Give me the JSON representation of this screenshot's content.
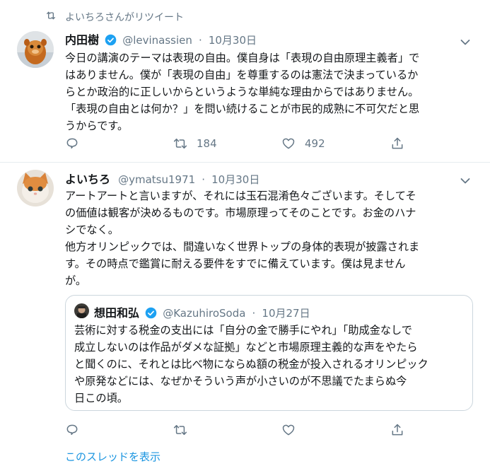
{
  "retweet_header": {
    "text": "よいちろさんがリツイート",
    "icon": "retweet-icon"
  },
  "tweets": [
    {
      "name": "内田樹",
      "handle": "@levinassien",
      "sep": "·",
      "date": "10月30日",
      "verified": true,
      "lines": [
        "今日の講演のテーマは表現の自由。僕自身は「表現の自由原理主義者」で",
        "はありません。僕が「表現の自由」を尊重するのは憲法で決まっているか",
        "らとか政治的に正しいからというような単純な理由からではありません。",
        "「表現の自由とは何か？」を問い続けることが市民的成熟に不可欠だと思",
        "うからです。"
      ],
      "actions": {
        "retweets": "184",
        "likes": "492"
      }
    },
    {
      "name": "よいちろ",
      "handle": "@ymatsu1971",
      "sep": "·",
      "date": "10月30日",
      "verified": false,
      "lines": [
        "アートアートと言いますが、それには玉石混淆色々ございます。そしてそ",
        "の価値は観客が決めるものです。市場原理ってそのことです。お金のハナ",
        "シでなく。",
        "他方オリンピックでは、間違いなく世界トップの身体的表現が披露されま",
        "す。その時点で鑑賞に耐える要件をすでに備えています。僕は見ません",
        "が。"
      ],
      "quote": {
        "name": "想田和弘",
        "handle": "@KazuhiroSoda",
        "sep": "·",
        "date": "10月27日",
        "verified": true,
        "lines": [
          "芸術に対する税金の支出には「自分の金で勝手にやれ」「助成金なしで",
          "成立しないのは作品がダメな証拠」などと市場原理主義的な声をやたら",
          "と聞くのに、それとは比べ物にならぬ額の税金が投入されるオリンピック",
          "や原発などには、なぜかそういう声が小さいのが不思議でたまらぬ今",
          "日この頃。"
        ]
      },
      "actions": {
        "retweets": "",
        "likes": ""
      }
    }
  ],
  "show_thread": "このスレッドを表示",
  "colors": {
    "accent": "#1da1f2",
    "link": "#1b95e0",
    "muted": "#657786",
    "text": "#14171a",
    "border": "#e6ecf0"
  }
}
